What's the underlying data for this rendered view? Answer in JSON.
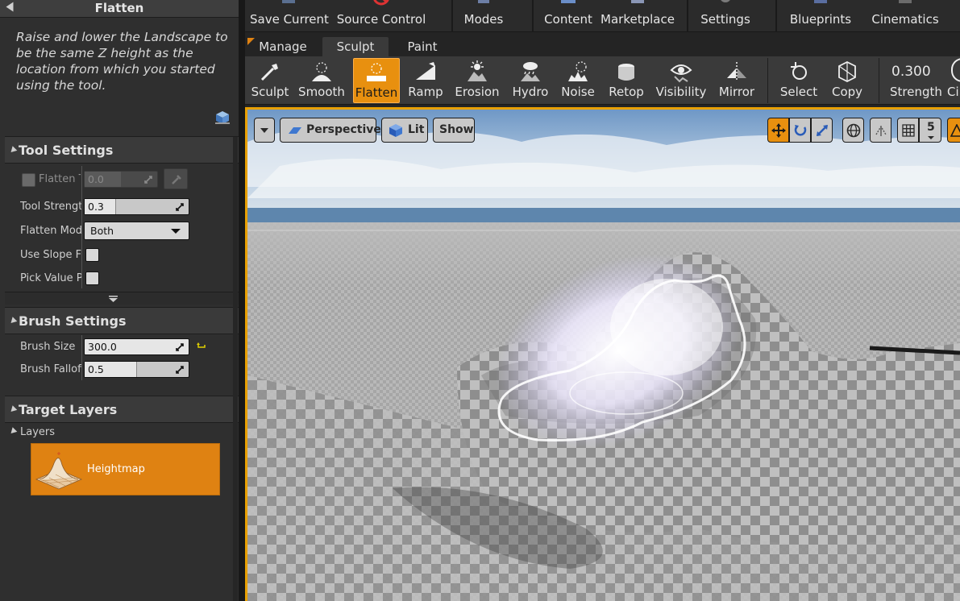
{
  "left_panel": {
    "tool_title": "Flatten",
    "tool_description": "Raise and lower the Landscape to be the same Z height as the location from which you started using the tool.",
    "tool_settings": {
      "header": "Tool Settings",
      "flatten_target_label": "Flatten T",
      "flatten_target_value": "0.0",
      "tool_strength_label": "Tool Strength",
      "tool_strength_value": "0.3",
      "tool_strength_fraction": 0.3,
      "flatten_mode_label": "Flatten Mode",
      "flatten_mode_value": "Both",
      "use_slope_label": "Use Slope Fla",
      "pick_value_label": "Pick Value Pe"
    },
    "brush_settings": {
      "header": "Brush Settings",
      "brush_size_label": "Brush Size",
      "brush_size_value": "300.0",
      "brush_falloff_label": "Brush Falloff",
      "brush_falloff_value": "0.5",
      "brush_falloff_fraction": 0.5
    },
    "target_layers": {
      "header": "Target Layers",
      "layers_label": "Layers",
      "layer_name": "Heightmap"
    }
  },
  "main_toolbar": {
    "save_current": "Save Current",
    "source_control": "Source Control",
    "modes": "Modes",
    "content": "Content",
    "marketplace": "Marketplace",
    "settings": "Settings",
    "blueprints": "Blueprints",
    "cinematics": "Cinematics"
  },
  "mode_tabs": [
    "Manage",
    "Sculpt",
    "Paint"
  ],
  "sculpt_tools": [
    "Sculpt",
    "Smooth",
    "Flatten",
    "Ramp",
    "Erosion",
    "Hydro",
    "Noise",
    "Retop",
    "Visibility",
    "Mirror"
  ],
  "selection_tools": [
    "Select",
    "Copy"
  ],
  "strength": {
    "value": "0.300",
    "label": "Strength"
  },
  "circle_label": "Cir",
  "viewport": {
    "perspective": "Perspective",
    "lit": "Lit",
    "show": "Show",
    "grid_size": "5"
  },
  "colors": {
    "accent": "#df8212",
    "panel": "#2f2f2f"
  }
}
